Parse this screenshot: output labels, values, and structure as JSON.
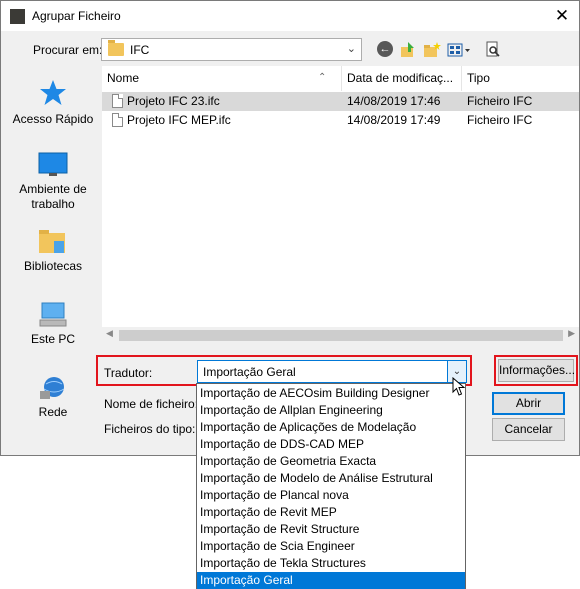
{
  "window": {
    "title": "Agrupar Ficheiro",
    "close_glyph": "✕"
  },
  "lookin": {
    "label": "Procurar em:",
    "path": "IFC"
  },
  "toolbar": {
    "back_glyph": "←"
  },
  "places": [
    {
      "label": "Acesso Rápido",
      "icon": "star-icon"
    },
    {
      "label": "Ambiente de trabalho",
      "icon": "desktop-icon"
    },
    {
      "label": "Bibliotecas",
      "icon": "libraries-icon"
    },
    {
      "label": "Este PC",
      "icon": "computer-icon"
    },
    {
      "label": "Rede",
      "icon": "network-icon"
    }
  ],
  "filelist": {
    "columns": [
      "Nome",
      "Data de modificaç...",
      "Tipo"
    ],
    "rows": [
      {
        "name": "Projeto IFC 23.ifc",
        "date": "14/08/2019 17:46",
        "type": "Ficheiro IFC",
        "selected": true
      },
      {
        "name": "Projeto IFC MEP.ifc",
        "date": "14/08/2019 17:49",
        "type": "Ficheiro IFC",
        "selected": false
      }
    ]
  },
  "form": {
    "tradutor_label": "Tradutor:",
    "tradutor_value": "Importação Geral",
    "filename_label": "Nome de ficheiro:",
    "filetype_label": "Ficheiros do tipo:"
  },
  "buttons": {
    "info": "Informações...",
    "open": "Abrir",
    "cancel": "Cancelar"
  },
  "dropdown_items": [
    "Importação de AECOsim Building Designer",
    "Importação de Allplan Engineering",
    "Importação de Aplicações de Modelação",
    "Importação de DDS-CAD MEP",
    "Importação de Geometria Exacta",
    "Importação de Modelo de Análise Estrutural",
    "Importação de Plancal nova",
    "Importação de Revit MEP",
    "Importação de Revit Structure",
    "Importação de Scia Engineer",
    "Importação de Tekla Structures",
    "Importação Geral"
  ],
  "colors": {
    "accent": "#0078d7",
    "highlight_frame": "#e2141c",
    "selected_row": "#d9d9d9"
  }
}
